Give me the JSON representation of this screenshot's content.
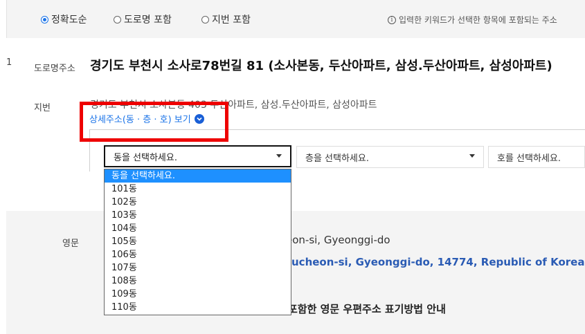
{
  "search_options": [
    {
      "label": "정확도순",
      "selected": true
    },
    {
      "label": "도로명 포함",
      "selected": false
    },
    {
      "label": "지번 포함",
      "selected": false
    }
  ],
  "info_text": "입력한 키워드가 선택한 항목에 포함되는 주소",
  "info_icon": "info-icon",
  "result": {
    "index": "1",
    "road_label": "도로명주소",
    "road_address": "경기도 부천시 소사로78번길 81 (소사본동, 두산아파트, 삼성.두산아파트, 삼성아파트)",
    "jibun_label": "지번",
    "jibun_address": "경기도 부천시 소사본동 403 두산아파트, 삼성.두산아파트, 삼성아파트",
    "detail_link": "상세주소(동 · 층 · 호) 보기",
    "detail_link_icon": "chevron-down-circle-icon"
  },
  "detail_selects": {
    "dong": "동을 선택하세요.",
    "floor": "층을 선택하세요.",
    "ho": "호를 선택하세요."
  },
  "dong_options": [
    "동을 선택하세요.",
    "101동",
    "102동",
    "103동",
    "104동",
    "105동",
    "106동",
    "107동",
    "108동",
    "109동",
    "110동"
  ],
  "dong_highlighted_index": 0,
  "english": {
    "label": "영문",
    "line1_visible": "eon-si, Gyeonggi-do",
    "line2_visible": "ucheon-si, Gyeonggi-do, 14774, Republic of Korea",
    "guide_visible": "포함한 영문 우편주소 표기방법 안내"
  },
  "colors": {
    "accent": "#1a73e8",
    "highlight": "#1e90ff",
    "annotation_box": "#ee0000",
    "english_link": "#2a5bb4"
  }
}
